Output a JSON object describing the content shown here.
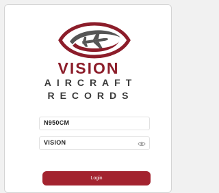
{
  "brand": {
    "name_line1": "VISION",
    "name_line2": "AIRCRAFT",
    "name_line3": "RECORDS",
    "primary_color": "#8c1d2a",
    "accent_gray": "#3a3a3a"
  },
  "form": {
    "tail_number_value": "N950CM",
    "password_value": "VISION",
    "password_toggle_icon": "eye-icon",
    "login_label": "Login",
    "button_color": "#a3232f"
  }
}
